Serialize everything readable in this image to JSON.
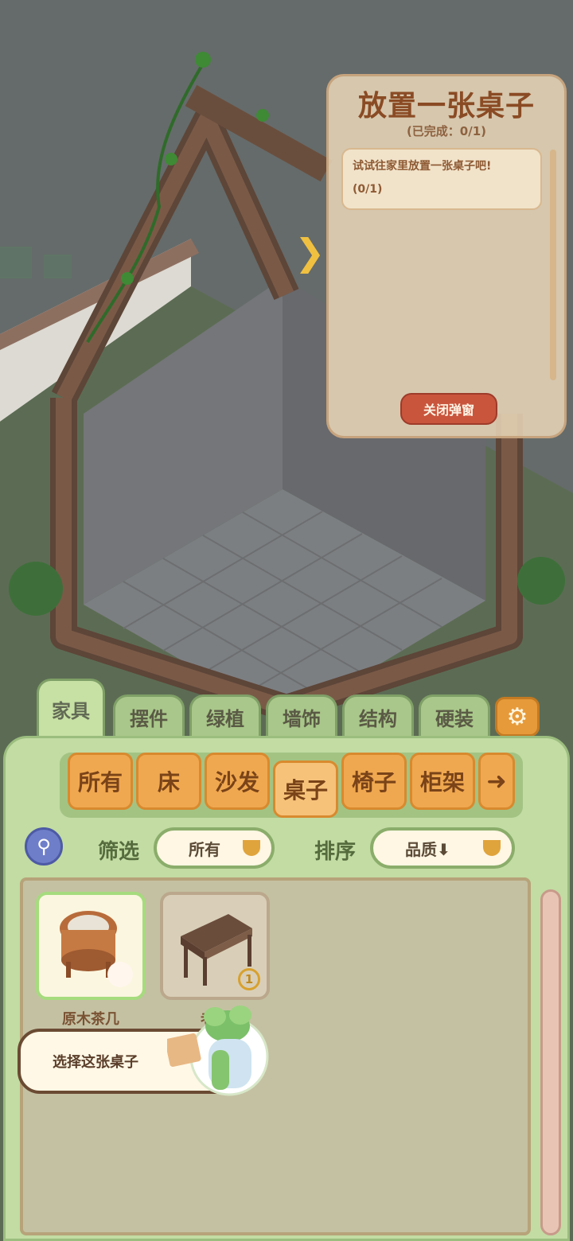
{
  "quest": {
    "title": "放置一张桌子",
    "progress": "(已完成：0/1)",
    "description": "试试往家里放置一张桌子吧!",
    "count": "(0/1)",
    "close_button": "关闭弹窗"
  },
  "category_tabs": [
    "家具",
    "摆件",
    "绿植",
    "墙饰",
    "结构",
    "硬装"
  ],
  "active_category": "家具",
  "subcategories": [
    "所有",
    "床",
    "沙发",
    "桌子",
    "椅子",
    "柜架"
  ],
  "active_subcategory": "桌子",
  "filter": {
    "label": "筛选",
    "value": "所有"
  },
  "sort": {
    "label": "排序",
    "value": "品质⬇"
  },
  "items": [
    {
      "name": "原木茶几",
      "selected": true
    },
    {
      "name": "老旧",
      "count": "1",
      "selected": false
    }
  ],
  "tutorial_tip": "选择这张桌子",
  "icons": {
    "next": "arrow-right-icon",
    "settings": "gear-icon",
    "search": "magnifier-icon",
    "quest_expand": "chevron-right-icon"
  },
  "colors": {
    "panel_green": "#c2dca3",
    "tab_orange": "#f0a850",
    "close_red": "#c9553d",
    "quest_title": "#8a4b24"
  }
}
